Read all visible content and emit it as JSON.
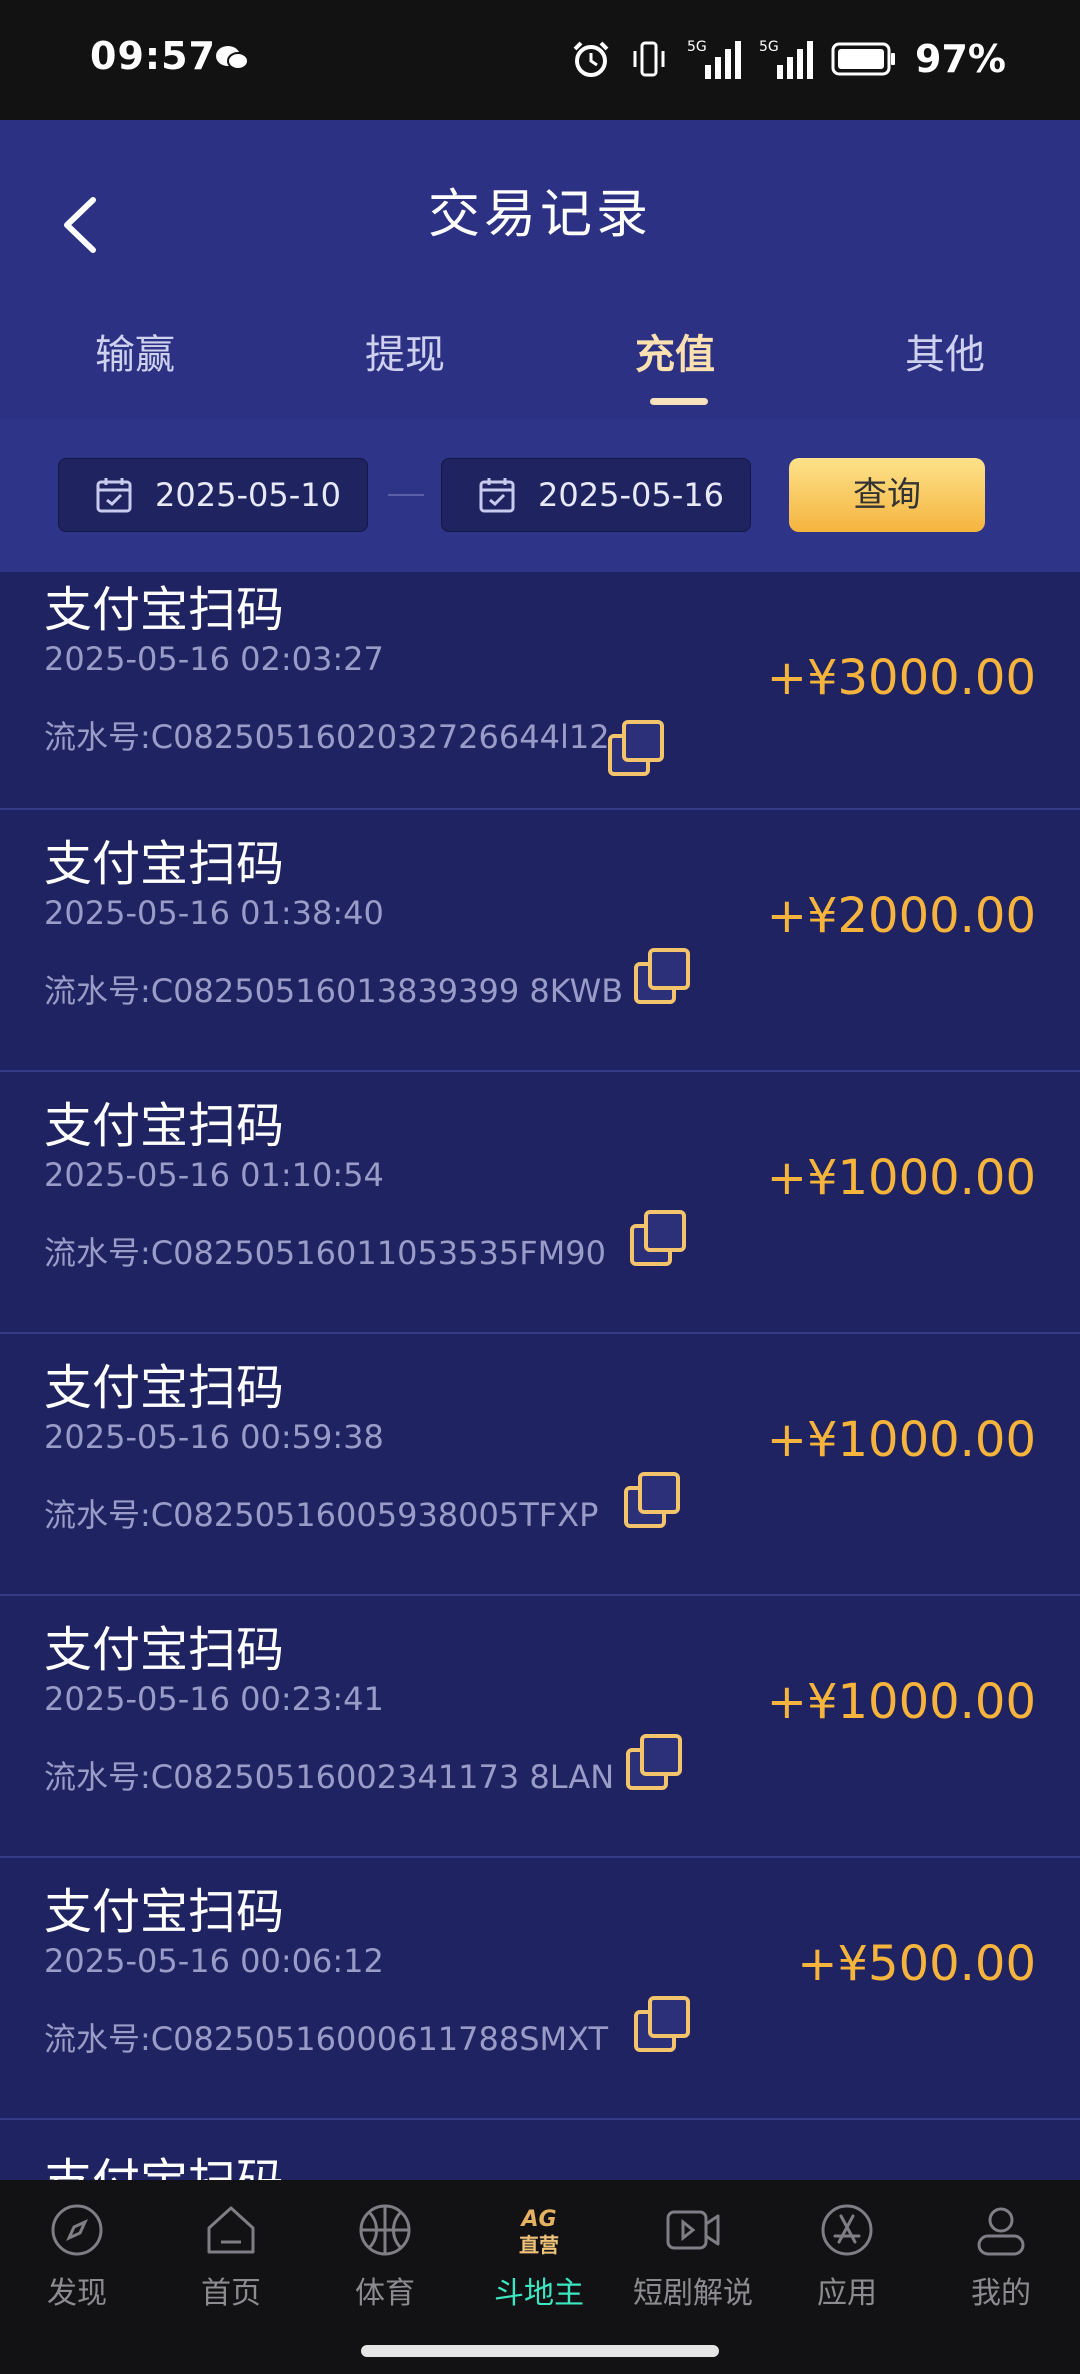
{
  "status": {
    "time": "09:57",
    "net1": "5G",
    "net2": "5G",
    "battery": "97%"
  },
  "header": {
    "title": "交易记录"
  },
  "tabs": [
    {
      "label": "输赢",
      "active": false
    },
    {
      "label": "提现",
      "active": false
    },
    {
      "label": "充值",
      "active": true
    },
    {
      "label": "其他",
      "active": false
    }
  ],
  "filter": {
    "start_date": "2025-05-10",
    "end_date": "2025-05-16",
    "query_label": "查询"
  },
  "records": [
    {
      "title": "支付宝扫码",
      "time": "2025-05-16 02:03:27",
      "serial": "流水号:C0825051602032726644l12",
      "amount": "+¥3000.00"
    },
    {
      "title": "支付宝扫码",
      "time": "2025-05-16 01:38:40",
      "serial": "流水号:C08250516013839399 8KWB",
      "amount": "+¥2000.00"
    },
    {
      "title": "支付宝扫码",
      "time": "2025-05-16 01:10:54",
      "serial": "流水号:C08250516011053535FM90",
      "amount": "+¥1000.00"
    },
    {
      "title": "支付宝扫码",
      "time": "2025-05-16 00:59:38",
      "serial": "流水号:C08250516005938005TFXP",
      "amount": "+¥1000.00"
    },
    {
      "title": "支付宝扫码",
      "time": "2025-05-16 00:23:41",
      "serial": "流水号:C08250516002341173 8LAN",
      "amount": "+¥1000.00"
    },
    {
      "title": "支付宝扫码",
      "time": "2025-05-16 00:06:12",
      "serial": "流水号:C08250516000611788SMXT",
      "amount": "+¥500.00"
    },
    {
      "title": "支付宝扫码",
      "time": "",
      "serial": "",
      "amount": ""
    }
  ],
  "tabbar": [
    {
      "label": "发现",
      "icon": "compass-icon",
      "active": false
    },
    {
      "label": "首页",
      "icon": "home-icon",
      "active": false
    },
    {
      "label": "体育",
      "icon": "basketball-icon",
      "active": false
    },
    {
      "label": "斗地主",
      "icon": "ag-direct-icon",
      "badge": "直营",
      "brand": "AG",
      "active": true
    },
    {
      "label": "短剧解说",
      "icon": "video-icon",
      "active": false
    },
    {
      "label": "应用",
      "icon": "app-store-icon",
      "active": false
    },
    {
      "label": "我的",
      "icon": "user-icon",
      "active": false
    }
  ]
}
